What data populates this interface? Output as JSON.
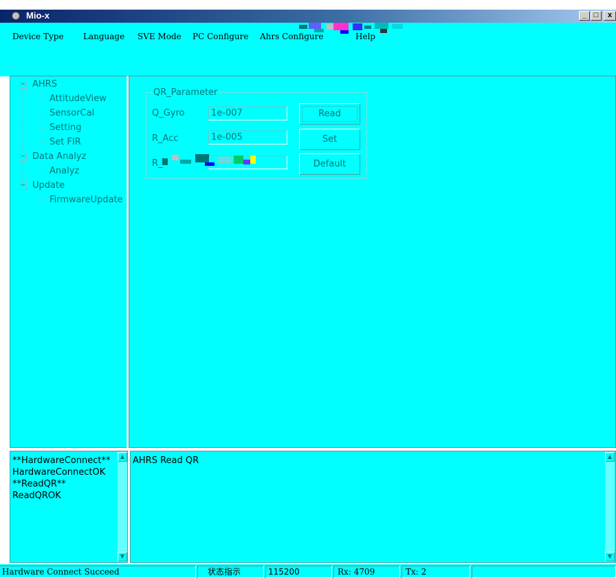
{
  "window": {
    "title": "Mio-x",
    "minimize_glyph": "_",
    "maximize_glyph": "□",
    "close_glyph": "x"
  },
  "menu": [
    "Device Type",
    "Language",
    "SVE Mode",
    "PC Configure",
    "Ahrs Configure",
    "Help"
  ],
  "tree": {
    "expanded_glyph": "−",
    "items": [
      {
        "label": "AHRS",
        "level": 0
      },
      {
        "label": "AttitudeView",
        "level": 1
      },
      {
        "label": "SensorCal",
        "level": 1
      },
      {
        "label": "Setting",
        "level": 1
      },
      {
        "label": "Set FIR",
        "level": 1
      },
      {
        "label": "Data Analyz",
        "level": 0
      },
      {
        "label": "Analyz",
        "level": 1
      },
      {
        "label": "Update",
        "level": 0
      },
      {
        "label": "FirmwareUpdate",
        "level": 1
      }
    ]
  },
  "qr_parameter": {
    "group_label": "QR_Parameter",
    "fields": [
      {
        "label": "Q_Gyro",
        "value": "1e-007"
      },
      {
        "label": "R_Acc",
        "value": "1e-005"
      },
      {
        "label": "R_",
        "value": ""
      }
    ],
    "buttons": {
      "read": "Read",
      "set": "Set",
      "default": "Default"
    }
  },
  "log_left": [
    "**HardwareConnect**",
    "HardwareConnectOK",
    "**ReadQR**",
    "ReadQROK"
  ],
  "log_right": [
    "AHRS Read QR"
  ],
  "scroll": {
    "up_glyph": "▲",
    "down_glyph": "▼"
  },
  "status": {
    "message": "Hardware Connect Succeed",
    "indicator": "状态指示",
    "baud": "115200",
    "rx": "Rx: 4709",
    "tx": "Tx: 2"
  },
  "colors": {
    "background": "#00ffff",
    "titlebar_start": "#0a246a",
    "text_teal": "#007777"
  }
}
